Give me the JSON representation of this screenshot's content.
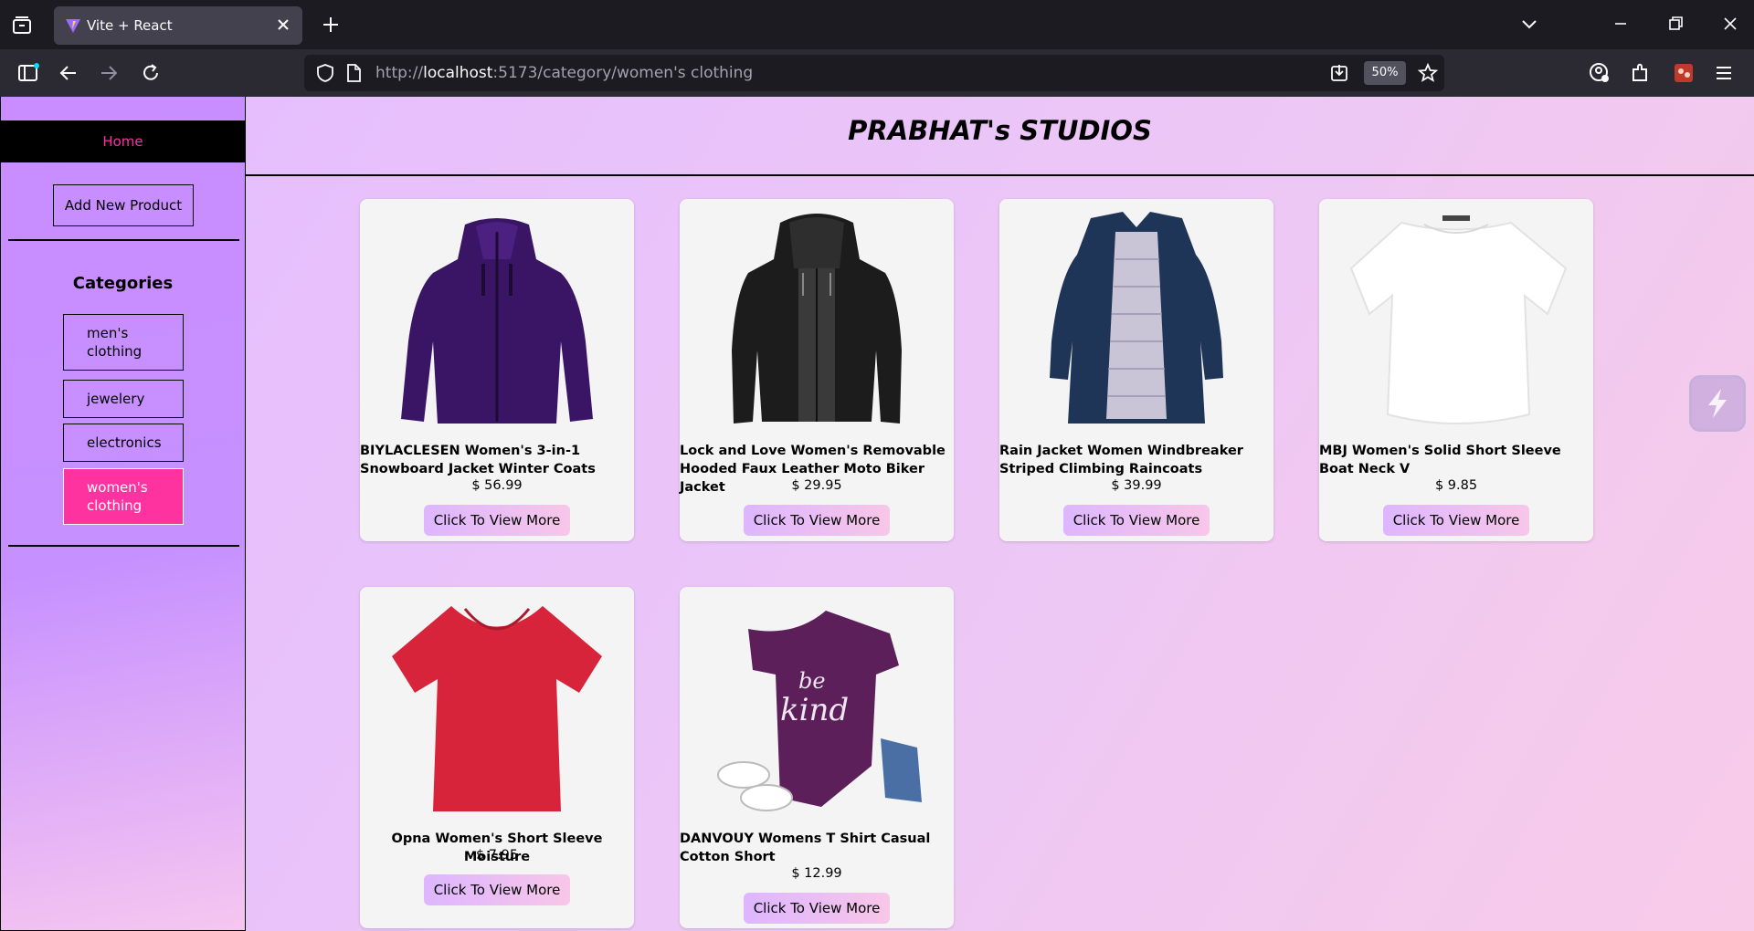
{
  "browser": {
    "tab_title": "Vite + React",
    "url_prefix": "http://",
    "url_host": "localhost",
    "url_rest": ":5173/category/women's clothing",
    "zoom": "50%"
  },
  "sidebar": {
    "home_label": "Home",
    "add_product_label": "Add New Product",
    "categories_title": "Categories",
    "categories": [
      {
        "label": "men's clothing",
        "active": false
      },
      {
        "label": "jewelery",
        "active": false
      },
      {
        "label": "electronics",
        "active": false
      },
      {
        "label": "women's clothing",
        "active": true
      }
    ]
  },
  "main": {
    "site_title": "PRABHAT's STUDIOS",
    "products": [
      {
        "name": "BIYLACLESEN Women's 3-in-1 Snowboard Jacket Winter Coats",
        "price": "$ 56.99",
        "button": "Click To View More",
        "image": "purple-jacket"
      },
      {
        "name": "Lock and Love Women's Removable Hooded Faux Leather Moto Biker Jacket",
        "price": "$ 29.95",
        "button": "Click To View More",
        "image": "black-leather-jacket"
      },
      {
        "name": "Rain Jacket Women Windbreaker Striped Climbing Raincoats",
        "price": "$ 39.99",
        "button": "Click To View More",
        "image": "navy-raincoat"
      },
      {
        "name": "MBJ Women's Solid Short Sleeve Boat Neck V",
        "price": "$ 9.85",
        "button": "Click To View More",
        "image": "white-top"
      },
      {
        "name": "Opna Women's Short Sleeve Moisture",
        "price": "$ 7.95",
        "button": "Click To View More",
        "image": "red-tshirt"
      },
      {
        "name": "DANVOUY Womens T Shirt Casual Cotton Short",
        "price": "$ 12.99",
        "button": "Click To View More",
        "image": "purple-tshirt-be-kind",
        "shirt_text_1": "be",
        "shirt_text_2": "kind"
      }
    ]
  },
  "colors": {
    "accent_pink": "#ff33a0",
    "sidebar_purple": "#c98dff",
    "button_gradient": "#ddb6ff"
  }
}
